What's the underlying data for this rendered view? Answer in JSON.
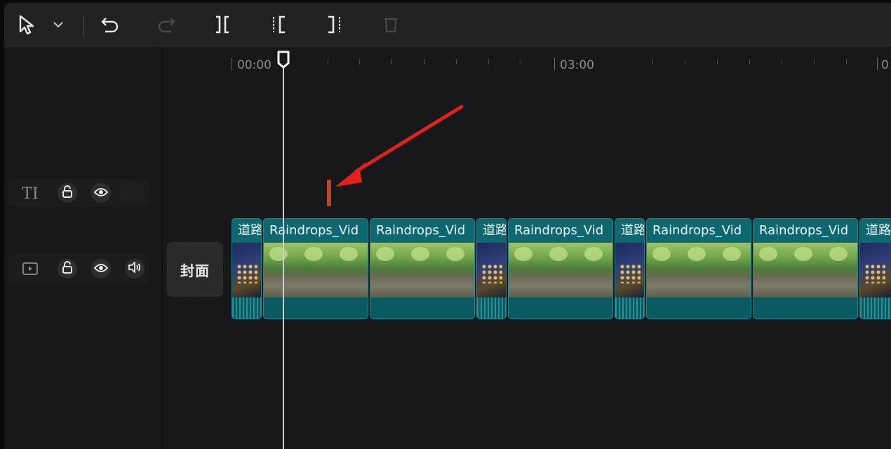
{
  "toolbar": {
    "items": [
      {
        "icon": "select-cursor-icon"
      },
      {
        "icon": "chevron-down-icon"
      },
      {
        "icon": "undo-icon"
      },
      {
        "icon": "redo-icon",
        "disabled": true
      },
      {
        "icon": "split-icon"
      },
      {
        "icon": "trim-left-icon"
      },
      {
        "icon": "trim-right-icon"
      },
      {
        "icon": "delete-icon",
        "disabled": true
      }
    ]
  },
  "tracks": {
    "text_track": {
      "type_icon_label": "TI",
      "buttons": [
        "lock-icon",
        "eye-icon"
      ]
    },
    "video_track": {
      "buttons": [
        "lock-icon",
        "eye-icon",
        "volume-icon"
      ]
    },
    "cover_label": "封面"
  },
  "ruler": {
    "labels": [
      "00:00",
      "03:00",
      "0"
    ]
  },
  "clips": [
    {
      "title": "道路",
      "thumb": "night"
    },
    {
      "title": "Raindrops_Vid",
      "thumb": "rain"
    },
    {
      "title": "Raindrops_Vid",
      "thumb": "rain"
    },
    {
      "title": "道路",
      "thumb": "night"
    },
    {
      "title": "Raindrops_Vid",
      "thumb": "rain"
    },
    {
      "title": "道路",
      "thumb": "night"
    },
    {
      "title": "Raindrops_Vid",
      "thumb": "rain"
    },
    {
      "title": "Raindrops_Vid",
      "thumb": "rain"
    },
    {
      "title": "道路",
      "thumb": "night"
    }
  ],
  "colors": {
    "accent_clip": "#0f6870",
    "marker": "#b7472a",
    "annotation_arrow": "#e0211c"
  }
}
